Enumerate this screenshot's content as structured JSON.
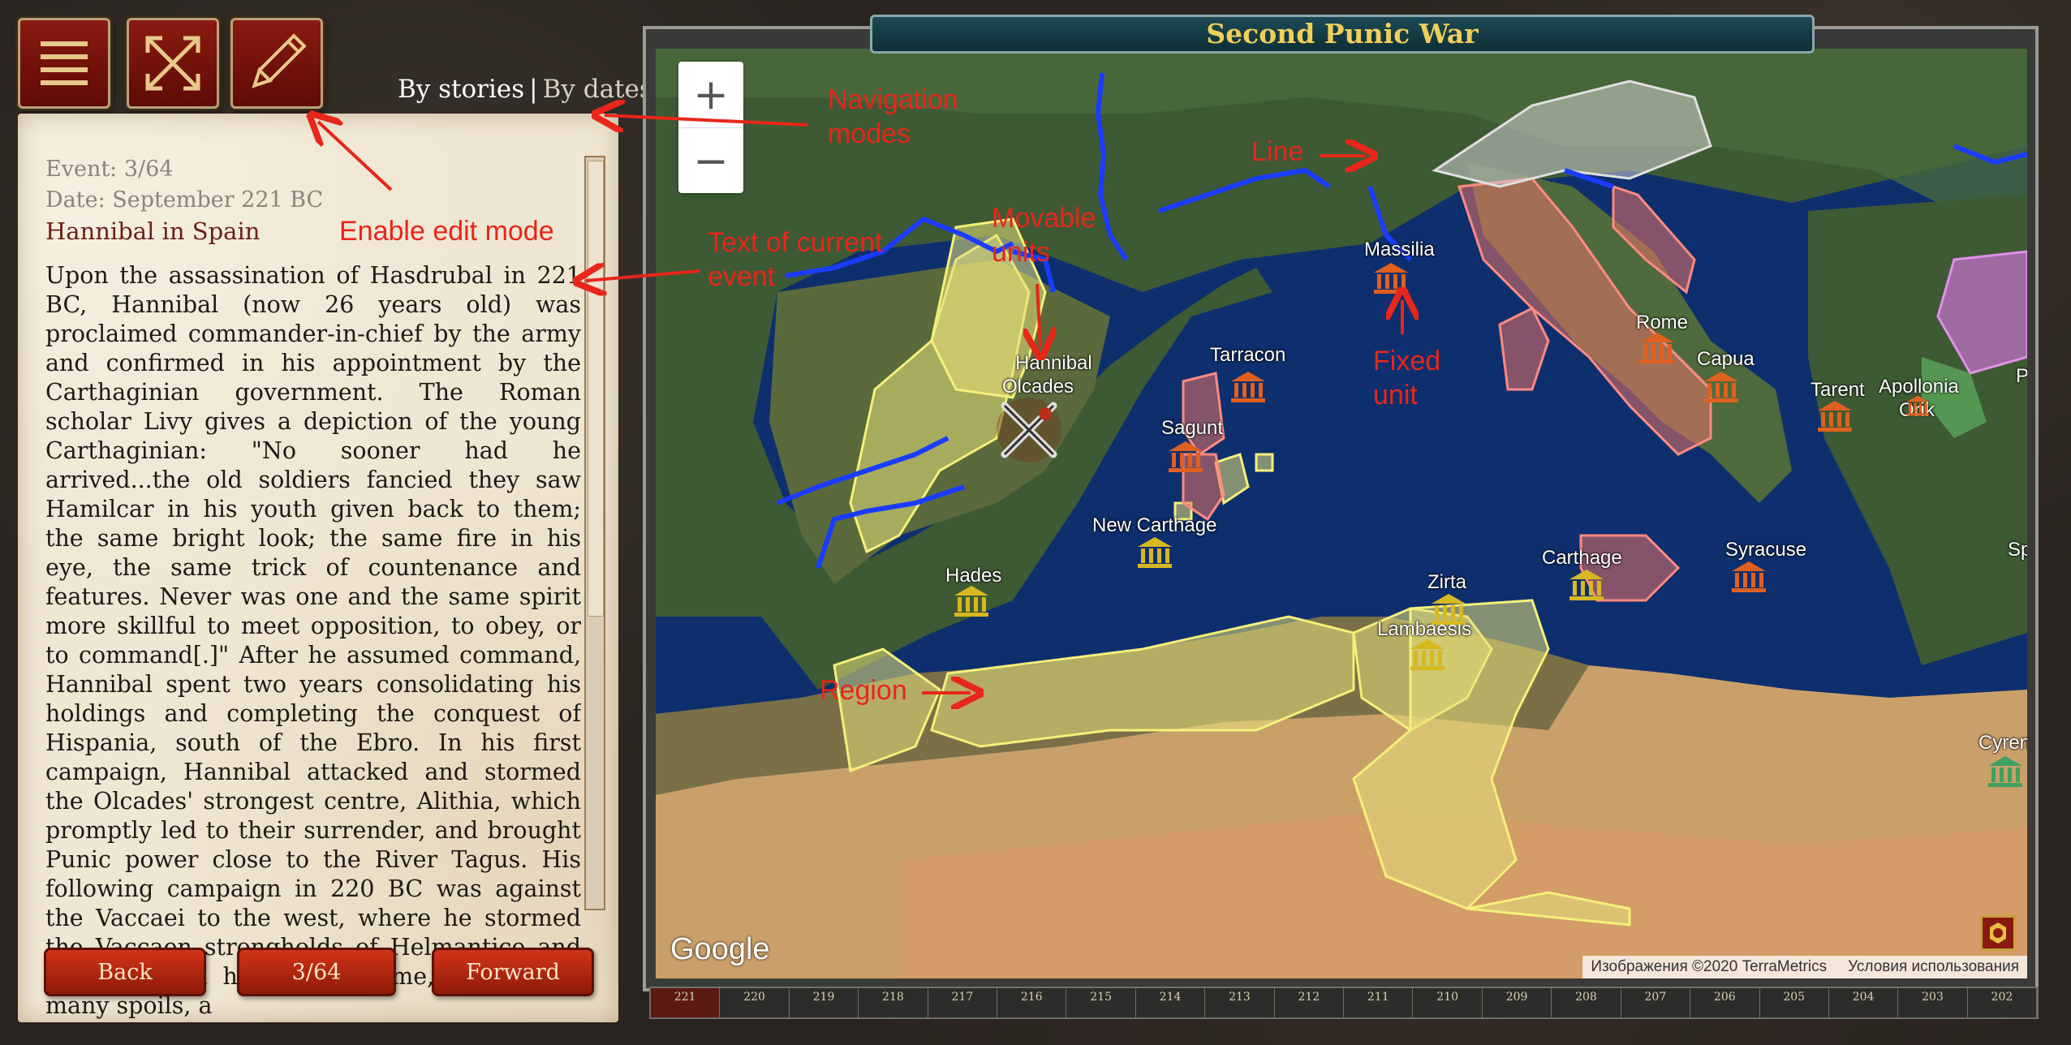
{
  "toolbar": {
    "menu_icon": "hamburger-icon",
    "fullscreen_icon": "expand-arrows-icon",
    "edit_icon": "pencil-icon"
  },
  "nav_modes": {
    "stories": "By stories",
    "separator": "|",
    "dates": "By dates"
  },
  "event": {
    "counter": "Event: 3/64",
    "date": "Date: September 221 BC",
    "title": "Hannibal in Spain",
    "text": "Upon the assassination of Hasdrubal in 221 BC, Hannibal (now 26 years old) was proclaimed commander-in-chief by the army and confirmed in his appointment by the Carthaginian government. The Roman scholar Livy gives a depiction of the young Carthaginian: \"No sooner had he arrived...the old soldiers fancied they saw Hamilcar in his youth given back to them; the same bright look; the same fire in his eye, the same trick of countenance and features. Never was one and the same spirit more skillful to meet opposition, to obey, or to command[.]\" After he assumed command, Hannibal spent two years consolidating his holdings and completing the conquest of Hispania, south of the Ebro. In his first campaign, Hannibal attacked and stormed the Olcades' strongest centre, Alithia, which promptly led to their surrender, and brought Punic power close to the River Tagus. His following campaign in 220 BC was against the Vaccaei to the west, where he stormed the Vaccaen strongholds of Helmantice and Arbucala. On his return home, laden with many spoils, a"
  },
  "buttons": {
    "back": "Back",
    "counter": "3/64",
    "forward": "Forward"
  },
  "map": {
    "title": "Second Punic War",
    "zoom_in": "+",
    "zoom_out": "−",
    "google": "Google",
    "attribution": "Изображения ©2020 TerraMetrics",
    "terms": "Условия использования",
    "places": {
      "hannibal": "Hannibal",
      "olcades": "Olcades",
      "tarracon": "Tarracon",
      "sagunt": "Sagunt",
      "new_carthage": "New Carthage",
      "hades": "Hades",
      "massilia": "Massilia",
      "rome": "Rome",
      "capua": "Capua",
      "tarent": "Tarent",
      "apollonia": "Apollonia",
      "orik": "Orik",
      "syracuse": "Syracuse",
      "carthage": "Carthage",
      "zirta": "Zirta",
      "lambaesis": "Lambaesis",
      "cyrene_partial": "Cyren",
      "sp_partial": "Sp",
      "p_partial": "P"
    },
    "colors": {
      "carthage_region": "#e6e07a",
      "rome_region": "#e8736a",
      "gaul_region": "#cfcfcf",
      "line": "#1a3cff",
      "sea": "#0e2f6e"
    }
  },
  "annotations": {
    "navigation_modes": "Navigation\nmodes",
    "enable_edit": "Enable edit mode",
    "text_of_event": "Text of current\nevent",
    "movable_units": "Movable\nunits",
    "line": "Line",
    "fixed_unit": "Fixed\nunit",
    "region": "Region"
  },
  "timeline": [
    "221",
    "220",
    "219",
    "218",
    "217",
    "216",
    "215",
    "214",
    "213",
    "212",
    "211",
    "210",
    "209",
    "208",
    "207",
    "206",
    "205",
    "204",
    "203",
    "202"
  ]
}
